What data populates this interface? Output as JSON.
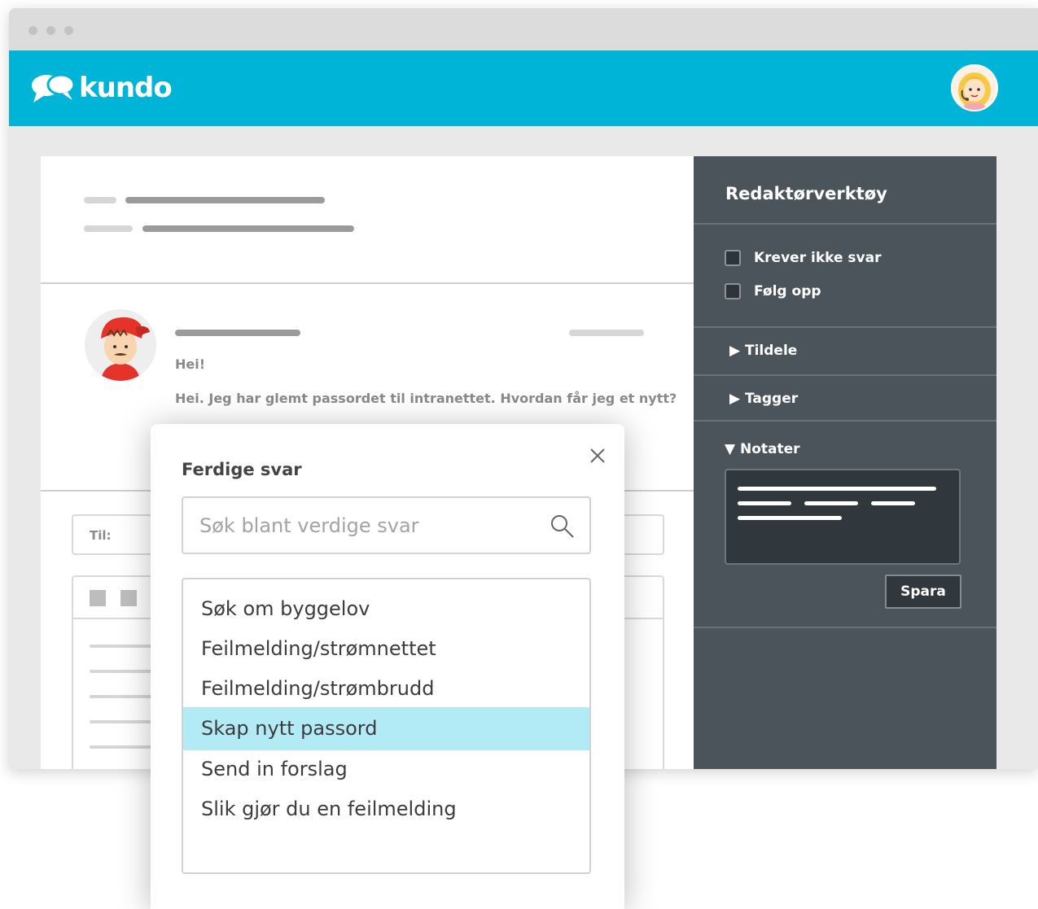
{
  "app": {
    "brand": "kundo",
    "accent_color": "#00b4d8"
  },
  "message": {
    "greeting": "Hei!",
    "body": "Hei. Jeg har glemt passordet til intranettet. Hvordan får jeg et nytt?"
  },
  "compose": {
    "to_label": "Til:"
  },
  "sidebar": {
    "title": "Redaktørverktøy",
    "checkboxes": [
      {
        "label": "Krever ikke svar",
        "checked": false
      },
      {
        "label": "Følg opp",
        "checked": false
      }
    ],
    "sections": [
      {
        "label": "Tildele",
        "expanded": false
      },
      {
        "label": "Tagger",
        "expanded": false
      },
      {
        "label": "Notater",
        "expanded": true
      }
    ],
    "save_label": "Spara"
  },
  "modal": {
    "title": "Ferdige svar",
    "search_placeholder": "Søk blant verdige svar",
    "items": [
      "Søk om byggelov",
      "Feilmelding/strømnettet",
      "Feilmelding/strømbrudd",
      "Skap nytt passord",
      "Send in forslag",
      "Slik gjør du en feilmelding"
    ],
    "selected_item": "Skap nytt passord",
    "selected_color": "#b2ebf5"
  }
}
